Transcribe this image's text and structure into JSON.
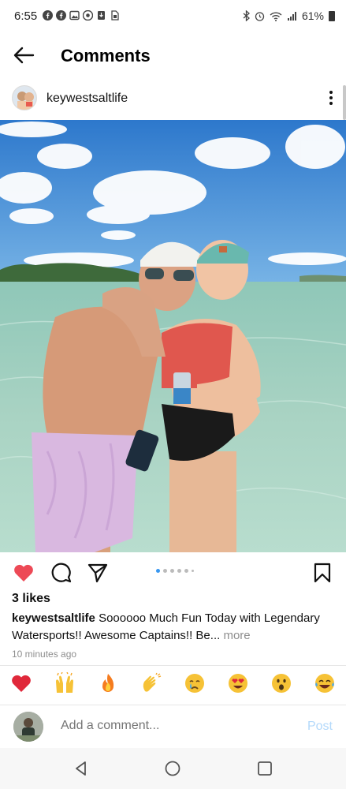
{
  "status_bar": {
    "time": "6:55",
    "battery": "61%",
    "left_icons": [
      "facebook-icon",
      "facebook-icon",
      "gallery-icon",
      "chrome-icon",
      "download-icon",
      "sim-icon"
    ],
    "right_icons": [
      "bluetooth-icon",
      "alarm-icon",
      "wifi-icon",
      "signal-icon",
      "battery-icon"
    ]
  },
  "header": {
    "title": "Comments"
  },
  "post": {
    "username": "keywestsaltlife",
    "likes": "3 likes",
    "caption_text": "Soooooo Much Fun Today with Legendary Watersports!! Awesome Captains!! Be...",
    "more_label": "more",
    "timestamp": "10 minutes ago",
    "liked": true,
    "carousel_total": 6,
    "carousel_active": 0
  },
  "quick_emojis": [
    "❤️",
    "🙌",
    "🔥",
    "👏",
    "😢",
    "😍",
    "😮",
    "😂"
  ],
  "comment_bar": {
    "placeholder": "Add a comment...",
    "post_label": "Post"
  },
  "colors": {
    "like_red": "#ed4956",
    "post_disabled_blue": "#b3d9fb",
    "carousel_active": "#3897f0"
  }
}
